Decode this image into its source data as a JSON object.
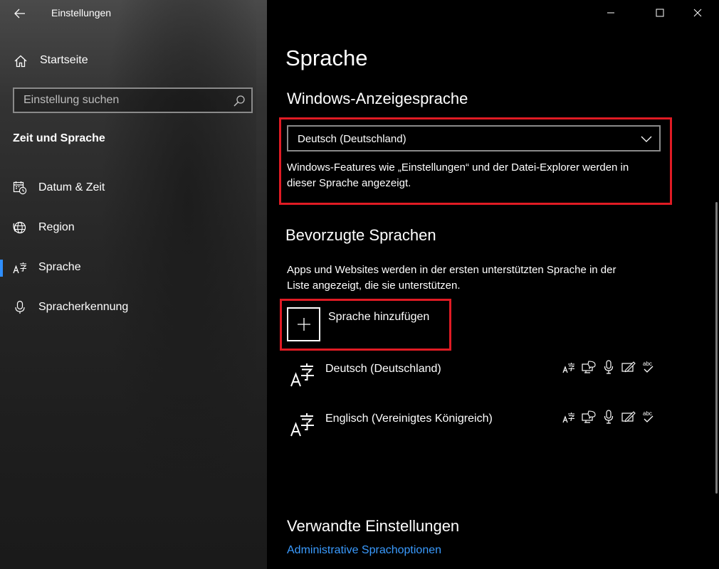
{
  "window": {
    "title": "Einstellungen"
  },
  "sidebar": {
    "home_label": "Startseite",
    "search": {
      "placeholder": "Einstellung suchen",
      "value": ""
    },
    "section_title": "Zeit und Sprache",
    "items": [
      {
        "label": "Datum & Zeit",
        "icon": "calendar-clock-icon",
        "active": false
      },
      {
        "label": "Region",
        "icon": "globe-icon",
        "active": false
      },
      {
        "label": "Sprache",
        "icon": "language-icon",
        "active": true
      },
      {
        "label": "Spracherkennung",
        "icon": "microphone-icon",
        "active": false
      }
    ]
  },
  "main": {
    "page_title": "Sprache",
    "display_language": {
      "heading": "Windows-Anzeigesprache",
      "selected": "Deutsch (Deutschland)",
      "description_line1": "Windows-Features wie „Einstellungen“ und der Datei-Explorer werden in",
      "description_line2": "dieser Sprache angezeigt."
    },
    "preferred_languages": {
      "heading": "Bevorzugte Sprachen",
      "description_line1": "Apps und Websites werden in der ersten unterstützten Sprache in der",
      "description_line2": "Liste angezeigt, die sie unterstützen.",
      "add_label": "Sprache hinzufügen",
      "languages": [
        {
          "name": "Deutsch (Deutschland)",
          "features": [
            "display-language-icon",
            "speech-icon",
            "microphone-icon",
            "handwriting-icon",
            "spellcheck-icon"
          ]
        },
        {
          "name": "Englisch (Vereinigtes Königreich)",
          "features": [
            "display-language-icon",
            "speech-icon",
            "microphone-icon",
            "handwriting-icon",
            "spellcheck-icon"
          ]
        }
      ]
    },
    "related": {
      "heading": "Verwandte Einstellungen",
      "link": "Administrative Sprachoptionen"
    }
  },
  "colors": {
    "accent": "#2f8fff",
    "link": "#3a9bff",
    "highlight_box": "#e01b24",
    "background": "#000000"
  }
}
